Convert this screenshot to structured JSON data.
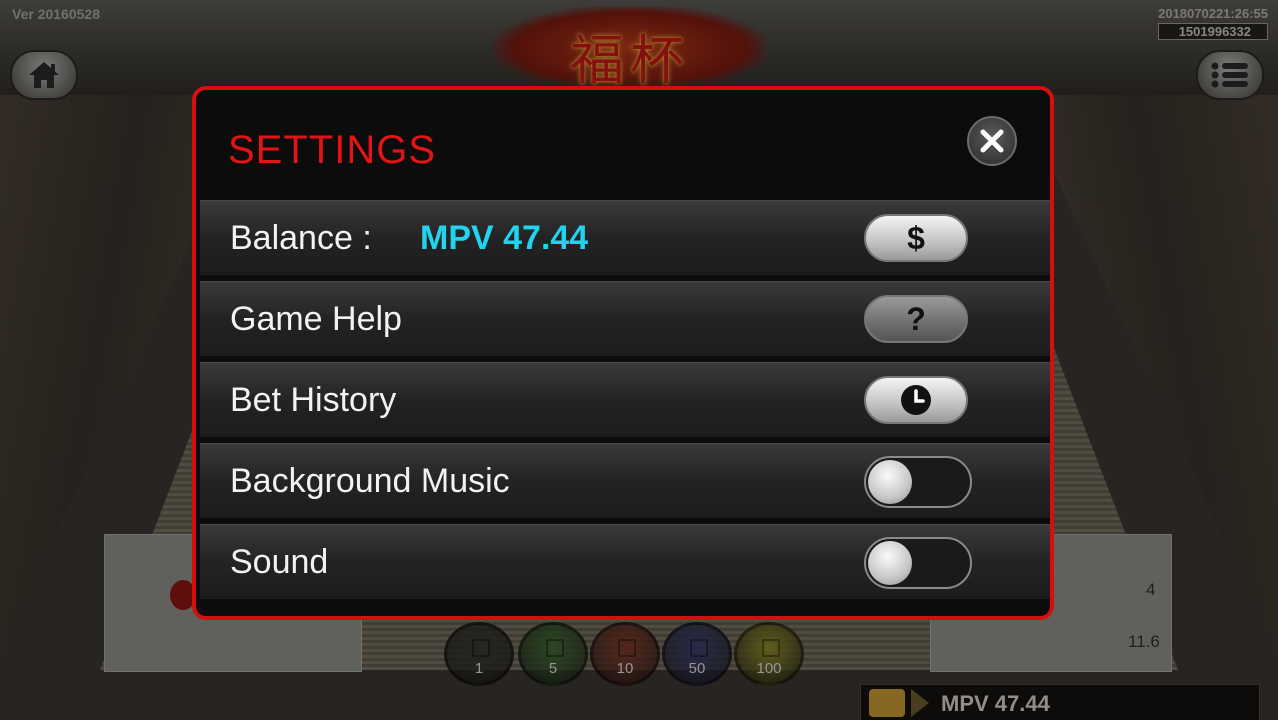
{
  "app": {
    "version": "Ver 20160528",
    "timestamp": "2018070221:26:55",
    "session_id": "1501996332",
    "logo_text": "福杯"
  },
  "table": {
    "payout_values": [
      "4",
      "11.6"
    ],
    "chips": [
      {
        "value": "1",
        "color": "#3a3a32"
      },
      {
        "value": "5",
        "color": "#3f6b34"
      },
      {
        "value": "10",
        "color": "#7e3a2a"
      },
      {
        "value": "50",
        "color": "#3b3f6e"
      },
      {
        "value": "100",
        "color": "#8e8a2a"
      }
    ]
  },
  "footer": {
    "balance": "MPV 47.44"
  },
  "settings": {
    "title": "SETTINGS",
    "rows": [
      {
        "label": "Balance :",
        "value": "MPV 47.44",
        "control": "dollar-button",
        "icon_text": "$"
      },
      {
        "label": "Game Help",
        "control": "help-button",
        "icon_text": "?"
      },
      {
        "label": "Bet History",
        "control": "history-button"
      },
      {
        "label": "Background Music",
        "control": "toggle",
        "on": false
      },
      {
        "label": "Sound",
        "control": "toggle",
        "on": false
      }
    ]
  },
  "colors": {
    "accent_red": "#d40f0f",
    "balance_cyan": "#22d3ef"
  }
}
